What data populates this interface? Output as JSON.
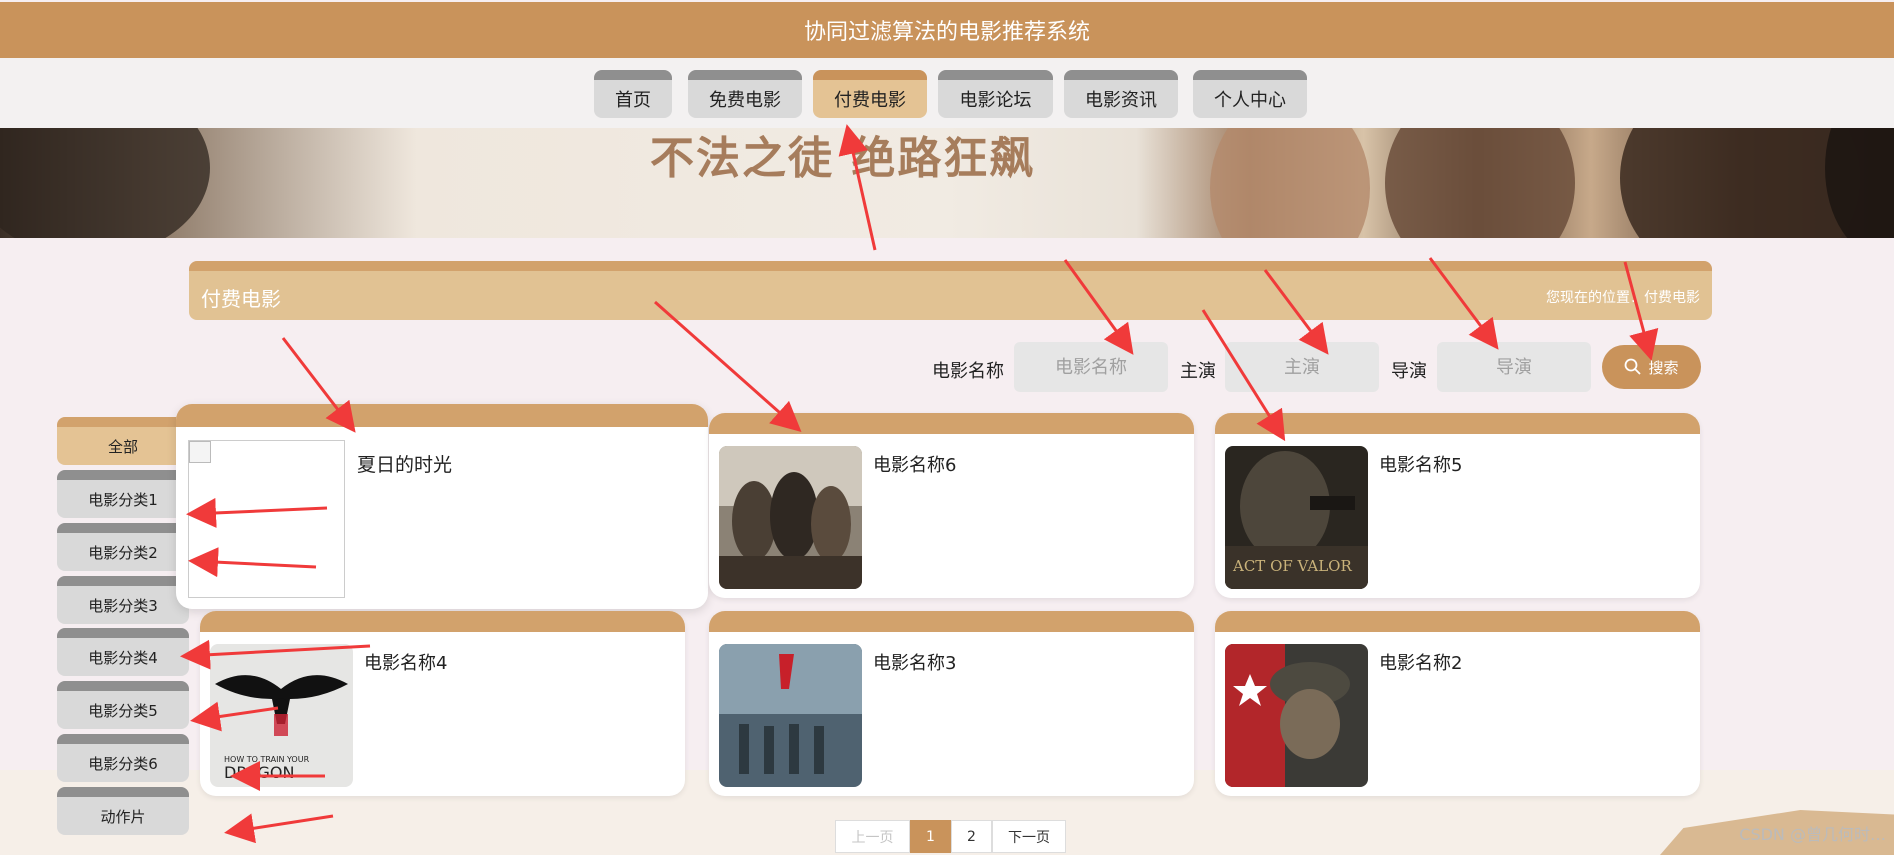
{
  "header": {
    "title": "协同过滤算法的电影推荐系统"
  },
  "nav": {
    "items": [
      {
        "label": "首页"
      },
      {
        "label": "免费电影"
      },
      {
        "label": "付费电影",
        "active": true
      },
      {
        "label": "电影论坛"
      },
      {
        "label": "电影资讯"
      },
      {
        "label": "个人中心"
      }
    ]
  },
  "banner": {
    "text": "不法之徒 绝路狂飙"
  },
  "section": {
    "title": "付费电影",
    "breadcrumb": "您现在的位置：付费电影"
  },
  "search": {
    "name_label": "电影名称",
    "name_placeholder": "电影名称",
    "actor_label": "主演",
    "actor_placeholder": "主演",
    "director_label": "导演",
    "director_placeholder": "导演",
    "button_label": "搜索"
  },
  "categories": [
    {
      "label": "全部",
      "active": true
    },
    {
      "label": "电影分类1"
    },
    {
      "label": "电影分类2"
    },
    {
      "label": "电影分类3"
    },
    {
      "label": "电影分类4"
    },
    {
      "label": "电影分类5"
    },
    {
      "label": "电影分类6"
    },
    {
      "label": "动作片"
    }
  ],
  "movies": [
    {
      "title": "夏日的时光",
      "poster": "broken-image"
    },
    {
      "title": "电影名称6",
      "poster": "war-drama-poster"
    },
    {
      "title": "电影名称5",
      "poster": "act-of-valor-poster"
    },
    {
      "title": "电影名称4",
      "poster": "how-to-train-your-dragon-poster"
    },
    {
      "title": "电影名称3",
      "poster": "military-parade-poster"
    },
    {
      "title": "电影名称2",
      "poster": "soldier-poster"
    }
  ],
  "posters": {
    "war_drama_text": "",
    "act_of_valor": "ACT OF VALOR",
    "dragon_line1": "HOW TO TRAIN YOUR",
    "dragon_line2": "DRAGON"
  },
  "pagination": {
    "prev": "上一页",
    "pages": [
      "1",
      "2"
    ],
    "current": "1",
    "next": "下一页"
  },
  "watermark": "CSDN @曾几何时…",
  "colors": {
    "accent": "#c9935b",
    "header_light": "#e1c293",
    "arrow": "#f03a3a"
  }
}
